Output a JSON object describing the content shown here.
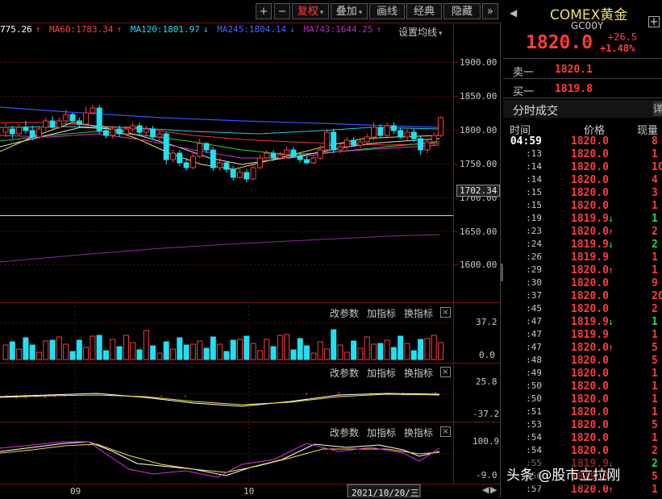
{
  "toolbar": {
    "plus": "+",
    "minus": "−",
    "fuquan": "复权",
    "diejia": "叠加",
    "huaxian": "画线",
    "jingdian": "经典",
    "yincang": "隐藏",
    "expand": "»"
  },
  "ma": {
    "ma_a": "775.26",
    "ma60": "MA60:1783.34",
    "ma120": "MA120:1801.97",
    "ma245": "MA245:1804.14",
    "ma743": "MA743:1644.25",
    "settings": "设置均线"
  },
  "price_axis": [
    "1900.00",
    "1850.00",
    "1800.00",
    "1750.00",
    "1700.00",
    "1650.00",
    "1600.00"
  ],
  "price_marker": "1702.34",
  "panels": {
    "btn_params": "改参数",
    "btn_add": "加指标",
    "btn_switch": "换指标",
    "close": "×",
    "vol_top": "37.2",
    "vol_bot": "0.0",
    "macd_top": "25.8",
    "macd_bot": "-37.2",
    "kdj_top": "100.9",
    "kdj_bot": "-9.0"
  },
  "date_axis": {
    "m09": "09",
    "m10": "10",
    "cursor_date": "2021/10/20/三"
  },
  "quote": {
    "name": "COMEX黄金",
    "code": "GC00Y",
    "price": "1820.0",
    "change": "+26.5",
    "change_pct": "+1.48%",
    "sell_label": "卖一",
    "sell_price": "1820.1",
    "buy_label": "买一",
    "buy_price": "1819.8",
    "ticks_title": "分时成交",
    "col_time": "时间",
    "col_price": "价格",
    "col_vol": "现量"
  },
  "ticks": [
    {
      "t": "04:59",
      "p": "1820.0",
      "a": "",
      "v": "8"
    },
    {
      "t": ":13",
      "p": "1820.0",
      "a": "",
      "v": "1"
    },
    {
      "t": ":14",
      "p": "1820.0",
      "a": "",
      "v": "10"
    },
    {
      "t": ":14",
      "p": "1820.0",
      "a": "",
      "v": "4"
    },
    {
      "t": ":15",
      "p": "1820.0",
      "a": "",
      "v": "3"
    },
    {
      "t": ":15",
      "p": "1820.0",
      "a": "",
      "v": "1"
    },
    {
      "t": ":19",
      "p": "1819.9",
      "a": "down",
      "v": "1"
    },
    {
      "t": ":23",
      "p": "1820.0",
      "a": "up",
      "v": "2"
    },
    {
      "t": ":24",
      "p": "1819.9",
      "a": "down",
      "v": "2"
    },
    {
      "t": ":26",
      "p": "1819.9",
      "a": "",
      "v": "1"
    },
    {
      "t": ":29",
      "p": "1820.0",
      "a": "up",
      "v": "1"
    },
    {
      "t": ":30",
      "p": "1820.0",
      "a": "",
      "v": "9"
    },
    {
      "t": ":37",
      "p": "1820.0",
      "a": "",
      "v": "20"
    },
    {
      "t": ":45",
      "p": "1820.0",
      "a": "",
      "v": "2"
    },
    {
      "t": ":47",
      "p": "1819.9",
      "a": "down",
      "v": "1"
    },
    {
      "t": ":47",
      "p": "1819.9",
      "a": "",
      "v": "1"
    },
    {
      "t": ":47",
      "p": "1820.0",
      "a": "up",
      "v": "5"
    },
    {
      "t": ":48",
      "p": "1820.0",
      "a": "",
      "v": "5"
    },
    {
      "t": ":49",
      "p": "1820.0",
      "a": "",
      "v": "1"
    },
    {
      "t": ":50",
      "p": "1820.0",
      "a": "",
      "v": "1"
    },
    {
      "t": ":50",
      "p": "1820.0",
      "a": "",
      "v": "1"
    },
    {
      "t": ":51",
      "p": "1820.0",
      "a": "",
      "v": "1"
    },
    {
      "t": ":53",
      "p": "1820.0",
      "a": "",
      "v": "5"
    },
    {
      "t": ":54",
      "p": "1820.0",
      "a": "",
      "v": "1"
    },
    {
      "t": ":54",
      "p": "1820.0",
      "a": "",
      "v": "2"
    },
    {
      "t": ":55",
      "p": "1819.9",
      "a": "down",
      "v": "2"
    },
    {
      "t": ":56",
      "p": "1819.9",
      "a": "",
      "v": "5"
    },
    {
      "t": ":57",
      "p": "1820.0",
      "a": "up",
      "v": "1"
    }
  ],
  "watermark": "头条 @股市立拉刚"
}
